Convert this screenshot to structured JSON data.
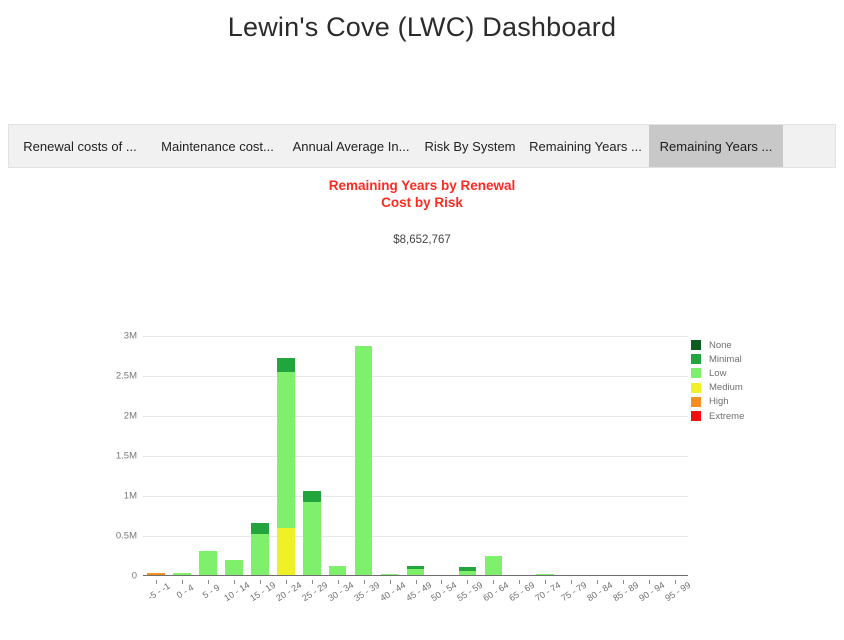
{
  "dashboard": {
    "title": "Lewin's Cove (LWC) Dashboard"
  },
  "tabs": [
    {
      "label": "Renewal costs of ...",
      "active": false
    },
    {
      "label": "Maintenance cost...",
      "active": false
    },
    {
      "label": "Annual Average In...",
      "active": false
    },
    {
      "label": "Risk By System",
      "active": false
    },
    {
      "label": "Remaining Years ...",
      "active": false
    },
    {
      "label": "Remaining Years ...",
      "active": true
    }
  ],
  "chart_panel": {
    "title": "Remaining Years by Renewal\nCost by Risk",
    "title_line1": "Remaining Years by Renewal",
    "title_line2": "Cost by Risk",
    "total_value": "$8,652,767",
    "title_color": "#fc2b20"
  },
  "chart_data": {
    "type": "bar",
    "subtype": "stacked",
    "title": "Remaining Years by Renewal Cost by Risk",
    "xlabel": "",
    "ylabel": "",
    "ylim": [
      0,
      3000000
    ],
    "grid": true,
    "legend_position": "right",
    "ytick_values": [
      0,
      500000,
      1000000,
      1500000,
      2000000,
      2500000,
      3000000
    ],
    "ytick_labels": [
      "0",
      "0.5M",
      "1M",
      "1.5M",
      "2M",
      "2.5M",
      "3M"
    ],
    "categories": [
      "-5 - -1",
      "0 - 4",
      "5 - 9",
      "10 - 14",
      "15 - 19",
      "20 - 24",
      "25 - 29",
      "30 - 34",
      "35 - 39",
      "40 - 44",
      "45 - 49",
      "50 - 54",
      "55 - 59",
      "60 - 64",
      "65 - 69",
      "70 - 74",
      "75 - 79",
      "80 - 84",
      "85 - 89",
      "90 - 94",
      "95 - 99"
    ],
    "series": [
      {
        "name": "None",
        "color": "#0a5c1f",
        "values": [
          0,
          0,
          0,
          0,
          0,
          0,
          0,
          0,
          0,
          0,
          0,
          0,
          0,
          0,
          0,
          0,
          0,
          0,
          0,
          0,
          0
        ]
      },
      {
        "name": "Minimal",
        "color": "#22a53c",
        "values": [
          0,
          0,
          0,
          0,
          140000,
          180000,
          130000,
          0,
          0,
          0,
          40000,
          0,
          50000,
          0,
          0,
          0,
          0,
          0,
          0,
          0,
          0
        ]
      },
      {
        "name": "Low",
        "color": "#7ef06b",
        "values": [
          0,
          35000,
          310000,
          200000,
          520000,
          1950000,
          930000,
          130000,
          2880000,
          30000,
          90000,
          0,
          60000,
          245000,
          0,
          30000,
          0,
          0,
          0,
          0,
          0
        ]
      },
      {
        "name": "Medium",
        "color": "#f0f028",
        "values": [
          0,
          0,
          0,
          0,
          0,
          600000,
          0,
          0,
          0,
          0,
          0,
          0,
          0,
          0,
          0,
          0,
          0,
          0,
          0,
          0,
          0
        ]
      },
      {
        "name": "High",
        "color": "#f29022",
        "values": [
          18000,
          0,
          0,
          0,
          0,
          0,
          0,
          0,
          0,
          0,
          0,
          0,
          0,
          0,
          0,
          0,
          0,
          0,
          0,
          0,
          0
        ]
      },
      {
        "name": "Extreme",
        "color": "#f01010",
        "values": [
          14000,
          0,
          0,
          0,
          0,
          0,
          0,
          0,
          0,
          0,
          0,
          0,
          0,
          0,
          0,
          0,
          0,
          0,
          0,
          0,
          0
        ]
      }
    ],
    "totals": [
      32000,
      35000,
      310000,
      200000,
      660000,
      2730000,
      1060000,
      130000,
      2880000,
      30000,
      130000,
      0,
      110000,
      245000,
      0,
      30000,
      0,
      0,
      0,
      0,
      0
    ]
  }
}
